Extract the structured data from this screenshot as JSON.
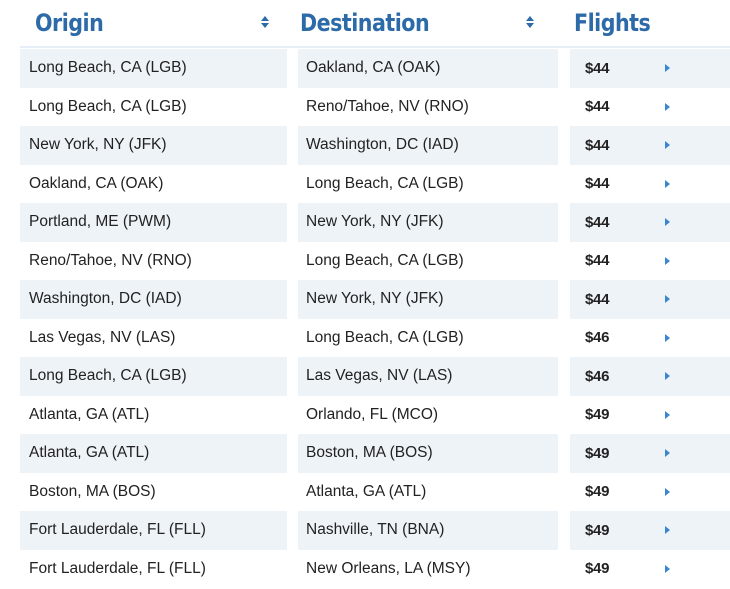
{
  "header": {
    "origin_label": "Origin",
    "destination_label": "Destination",
    "flights_label": "Flights",
    "sort_icon": "sort-updown-icon"
  },
  "colors": {
    "header_text": "#2d6aa8",
    "stripe": "#eef3f8",
    "arrow": "#3a86d0"
  },
  "rows": [
    {
      "origin": "Long Beach, CA (LGB)",
      "destination": "Oakland, CA (OAK)",
      "price": "$44"
    },
    {
      "origin": "Long Beach, CA (LGB)",
      "destination": "Reno/Tahoe, NV (RNO)",
      "price": "$44"
    },
    {
      "origin": "New York, NY (JFK)",
      "destination": "Washington, DC (IAD)",
      "price": "$44"
    },
    {
      "origin": "Oakland, CA (OAK)",
      "destination": "Long Beach, CA (LGB)",
      "price": "$44"
    },
    {
      "origin": "Portland, ME (PWM)",
      "destination": "New York, NY (JFK)",
      "price": "$44"
    },
    {
      "origin": "Reno/Tahoe, NV (RNO)",
      "destination": "Long Beach, CA (LGB)",
      "price": "$44"
    },
    {
      "origin": "Washington, DC (IAD)",
      "destination": "New York, NY (JFK)",
      "price": "$44"
    },
    {
      "origin": "Las Vegas, NV (LAS)",
      "destination": "Long Beach, CA (LGB)",
      "price": "$46"
    },
    {
      "origin": "Long Beach, CA (LGB)",
      "destination": "Las Vegas, NV (LAS)",
      "price": "$46"
    },
    {
      "origin": "Atlanta, GA (ATL)",
      "destination": "Orlando, FL (MCO)",
      "price": "$49"
    },
    {
      "origin": "Atlanta, GA (ATL)",
      "destination": "Boston, MA (BOS)",
      "price": "$49"
    },
    {
      "origin": "Boston, MA (BOS)",
      "destination": "Atlanta, GA (ATL)",
      "price": "$49"
    },
    {
      "origin": "Fort Lauderdale, FL (FLL)",
      "destination": "Nashville, TN (BNA)",
      "price": "$49"
    },
    {
      "origin": "Fort Lauderdale, FL (FLL)",
      "destination": "New Orleans, LA (MSY)",
      "price": "$49"
    }
  ]
}
